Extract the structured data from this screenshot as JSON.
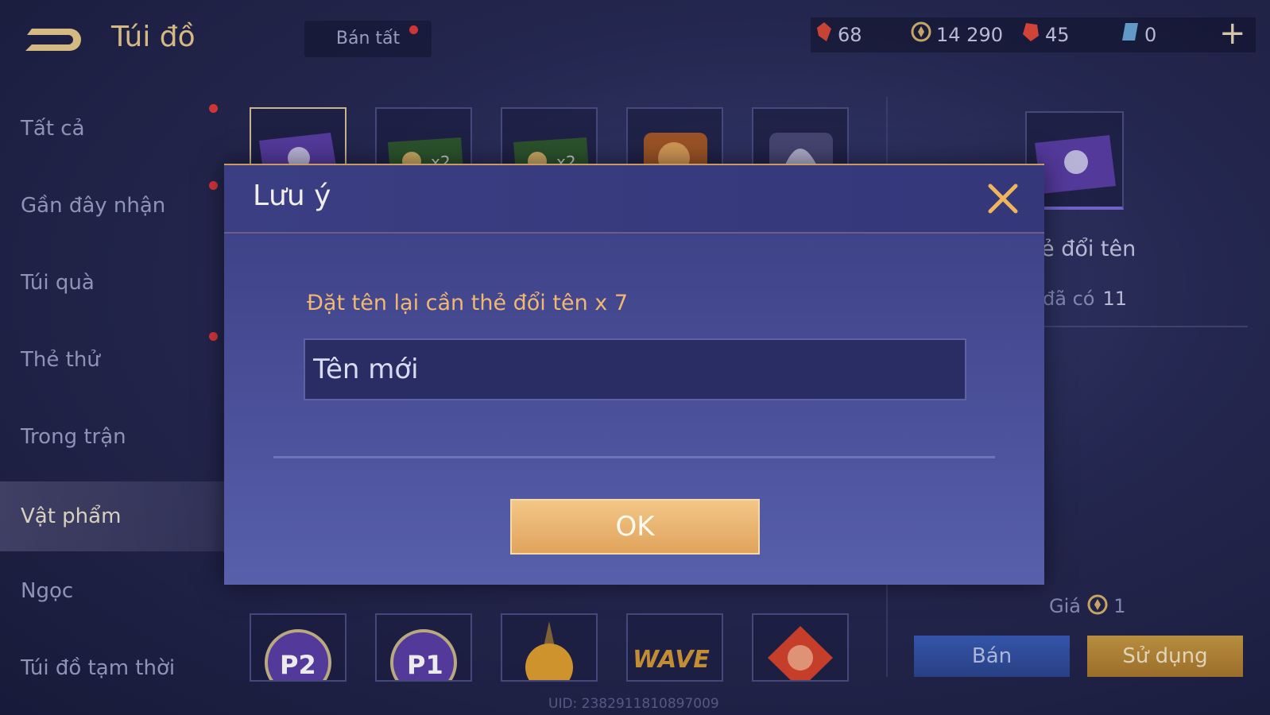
{
  "header": {
    "title": "Túi đồ",
    "sell_all_label": "Bán tất",
    "back_icon": "back-arrow-icon",
    "plus_icon": "plus-icon"
  },
  "currencies": [
    {
      "name": "red-crystal",
      "value": "68",
      "color": "#d84a3a"
    },
    {
      "name": "gold-coin",
      "value": "14 290",
      "color": "#d6b46a"
    },
    {
      "name": "ruby",
      "value": "45",
      "color": "#e04a3c"
    },
    {
      "name": "voucher",
      "value": "0",
      "color": "#6aa7d8"
    }
  ],
  "sidebar": {
    "items": [
      {
        "label": "Tất cả",
        "dot": true
      },
      {
        "label": "Gần đây nhận",
        "dot": true
      },
      {
        "label": "Túi quà",
        "dot": false
      },
      {
        "label": "Thẻ thử",
        "dot": true
      },
      {
        "label": "Trong trận",
        "dot": false
      },
      {
        "label": "Vật phẩm",
        "dot": false,
        "active": true
      },
      {
        "label": "Ngọc",
        "dot": false
      },
      {
        "label": "Túi đồ tạm thời",
        "dot": false
      }
    ]
  },
  "items_grid": {
    "row1": [
      {
        "icon": "rename-card-icon",
        "selected": true
      },
      {
        "icon": "gold-card-x2-icon",
        "badge": "x2"
      },
      {
        "icon": "gold-card-x2-icon",
        "badge": "x2"
      },
      {
        "icon": "treasure-chest-icon"
      },
      {
        "icon": "helmet-icon"
      }
    ],
    "row2": [
      {
        "icon": "p2-emblem-icon",
        "text": "P2"
      },
      {
        "icon": "p1-emblem-icon",
        "text": "P1"
      },
      {
        "icon": "pumpkin-icon"
      },
      {
        "icon": "wave-logo-icon",
        "text": "WAVE"
      },
      {
        "icon": "red-gem-icon"
      }
    ]
  },
  "detail": {
    "name": "ẻ đổi tên",
    "have_label": "đã có",
    "have_value": "11",
    "price_label": "Giá",
    "price_value": "1",
    "sell_label": "Bán",
    "use_label": "Sử dụng"
  },
  "uid": "UID: 2382911810897009",
  "dialog": {
    "title": "Lưu ý",
    "prompt": "Đặt tên lại cần thẻ đổi tên x 7",
    "input_placeholder": "Tên mới",
    "input_value": "",
    "ok_label": "OK",
    "close_icon": "close-icon"
  },
  "colors": {
    "accent_gold": "#e6c98e",
    "prompt_orange": "#f0b872",
    "notification_red": "#e03b3b"
  }
}
